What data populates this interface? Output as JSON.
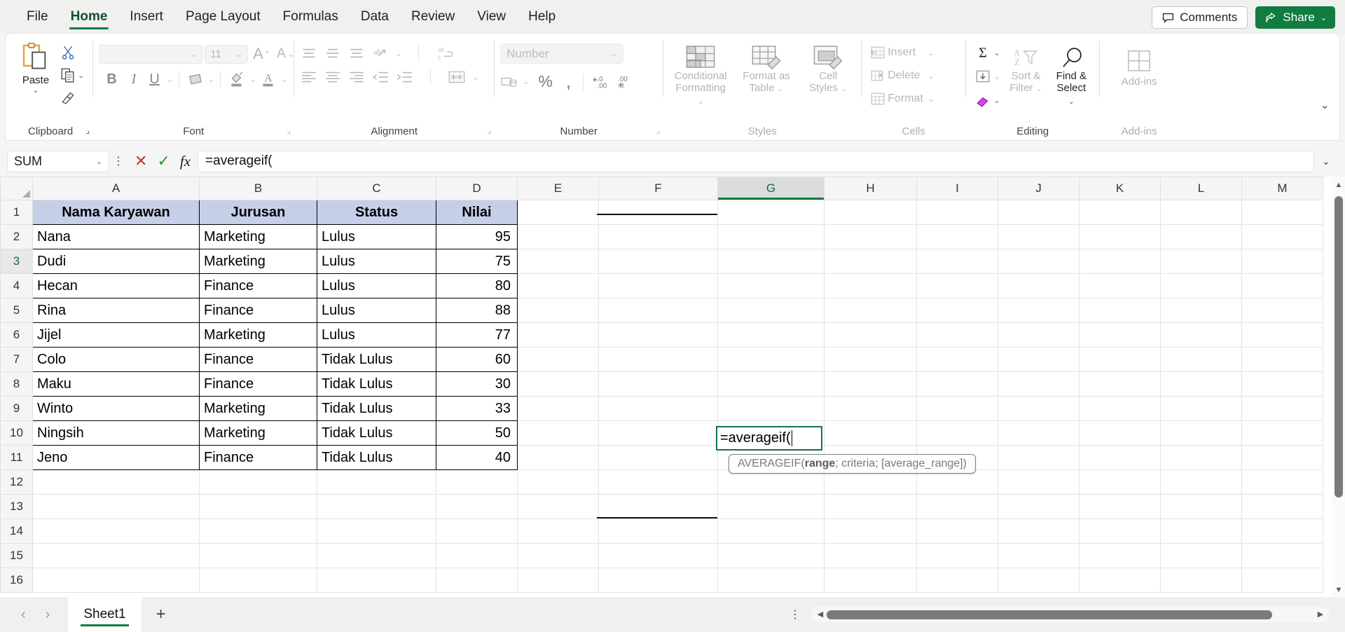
{
  "app": {
    "ribbon_tabs": [
      "File",
      "Home",
      "Insert",
      "Page Layout",
      "Formulas",
      "Data",
      "Review",
      "View",
      "Help"
    ],
    "active_tab": "Home",
    "comments_label": "Comments",
    "share_label": "Share",
    "accent_color": "#107c41",
    "header_fill_color": "#c6cfe8"
  },
  "ribbon": {
    "groups": [
      {
        "name": "Clipboard",
        "label": "Clipboard"
      },
      {
        "name": "Font",
        "label": "Font"
      },
      {
        "name": "Alignment",
        "label": "Alignment"
      },
      {
        "name": "Number",
        "label": "Number"
      },
      {
        "name": "Styles",
        "label": "Styles"
      },
      {
        "name": "Cells",
        "label": "Cells"
      },
      {
        "name": "Editing",
        "label": "Editing"
      },
      {
        "name": "Add-ins",
        "label": "Add-ins"
      }
    ],
    "clipboard": {
      "paste_label": "Paste",
      "cut_icon": "scissors-icon",
      "copy_icon": "copy-icon",
      "format_painter_icon": "format-painter-icon"
    },
    "font": {
      "font_name_value": "",
      "font_size_value": "11",
      "grow_font": "A",
      "shrink_font": "A",
      "bold": "B",
      "italic": "I",
      "underline": "U",
      "borders_icon": "borders-icon",
      "fill_color_icon": "fill-color-icon",
      "font_color_icon": "font-color-icon"
    },
    "alignment": {
      "top_align_icon": "align-top-icon",
      "middle_align_icon": "align-middle-icon",
      "bottom_align_icon": "align-bottom-icon",
      "orientation_icon": "orientation-icon",
      "align_left_icon": "align-left-icon",
      "align_center_icon": "align-center-icon",
      "align_right_icon": "align-right-icon",
      "decrease_indent_icon": "decrease-indent-icon",
      "increase_indent_icon": "increase-indent-icon",
      "wrap_text_icon": "wrap-text-icon",
      "merge_center_icon": "merge-center-icon"
    },
    "number": {
      "format_value": "Number",
      "accounting_icon": "accounting-format-icon",
      "percent_label": "%",
      "comma_label": ",",
      "decrease_decimal_icon": "decrease-decimal-icon",
      "increase_decimal_icon": "increase-decimal-icon"
    },
    "styles": {
      "conditional_formatting": "Conditional\nFormatting",
      "conditional_formatting_l1": "Conditional",
      "conditional_formatting_l2": "Formatting",
      "format_as_table_l1": "Format as",
      "format_as_table_l2": "Table",
      "cell_styles_l1": "Cell",
      "cell_styles_l2": "Styles"
    },
    "cells": {
      "insert_label": "Insert",
      "delete_label": "Delete",
      "format_label": "Format"
    },
    "editing": {
      "autosum_icon": "autosum-sigma-icon",
      "fill_icon": "fill-down-icon",
      "clear_icon": "clear-eraser-icon",
      "sort_filter_l1": "Sort &",
      "sort_filter_l2": "Filter",
      "find_select_l1": "Find &",
      "find_select_l2": "Select"
    },
    "addins": {
      "label": "Add-ins"
    }
  },
  "formula_bar": {
    "name_box_value": "SUM",
    "cancel_icon": "cancel-x-icon",
    "enter_icon": "enter-check-icon",
    "insert_function_icon": "fx-icon",
    "formula_value": "=averageif(",
    "expand_icon": "chevron-down-icon"
  },
  "grid": {
    "column_headers": [
      "A",
      "B",
      "C",
      "D",
      "E",
      "F",
      "G",
      "H",
      "I",
      "J",
      "K",
      "L",
      "M"
    ],
    "selected_column": "G",
    "selected_row": "3",
    "row_headers": [
      "1",
      "2",
      "3",
      "4",
      "5",
      "6",
      "7",
      "8",
      "9",
      "10",
      "11",
      "12",
      "13",
      "14",
      "15",
      "16"
    ],
    "table_headers": [
      "Nama Karyawan",
      "Jurusan",
      "Status",
      "Nilai"
    ],
    "rows": [
      {
        "nama": "Nana",
        "jurusan": "Marketing",
        "status": "Lulus",
        "nilai": "95"
      },
      {
        "nama": "Dudi",
        "jurusan": "Marketing",
        "status": "Lulus",
        "nilai": "75"
      },
      {
        "nama": "Hecan",
        "jurusan": "Finance",
        "status": "Lulus",
        "nilai": "80"
      },
      {
        "nama": "Rina",
        "jurusan": "Finance",
        "status": "Lulus",
        "nilai": "88"
      },
      {
        "nama": "Jijel",
        "jurusan": "Marketing",
        "status": "Lulus",
        "nilai": "77"
      },
      {
        "nama": "Colo",
        "jurusan": "Finance",
        "status": "Tidak Lulus",
        "nilai": "60"
      },
      {
        "nama": "Maku",
        "jurusan": "Finance",
        "status": "Tidak Lulus",
        "nilai": "30"
      },
      {
        "nama": "Winto",
        "jurusan": "Marketing",
        "status": "Tidak Lulus",
        "nilai": "33"
      },
      {
        "nama": "Ningsih",
        "jurusan": "Marketing",
        "status": "Tidak Lulus",
        "nilai": "50"
      },
      {
        "nama": "Jeno",
        "jurusan": "Finance",
        "status": "Tidak Lulus",
        "nilai": "40"
      }
    ],
    "editing_cell": {
      "address": "G3",
      "text": "=averageif("
    },
    "formula_tooltip": {
      "prefix": "AVERAGEIF(",
      "bold_arg": "range",
      "rest": "; criteria; [average_range])"
    }
  },
  "status_bar": {
    "prev_sheet_icon": "chevron-left-icon",
    "next_sheet_icon": "chevron-right-icon",
    "sheet_tabs": [
      "Sheet1"
    ],
    "active_sheet": "Sheet1",
    "add_sheet_icon": "plus-icon",
    "options_icon": "kebab-icon"
  }
}
